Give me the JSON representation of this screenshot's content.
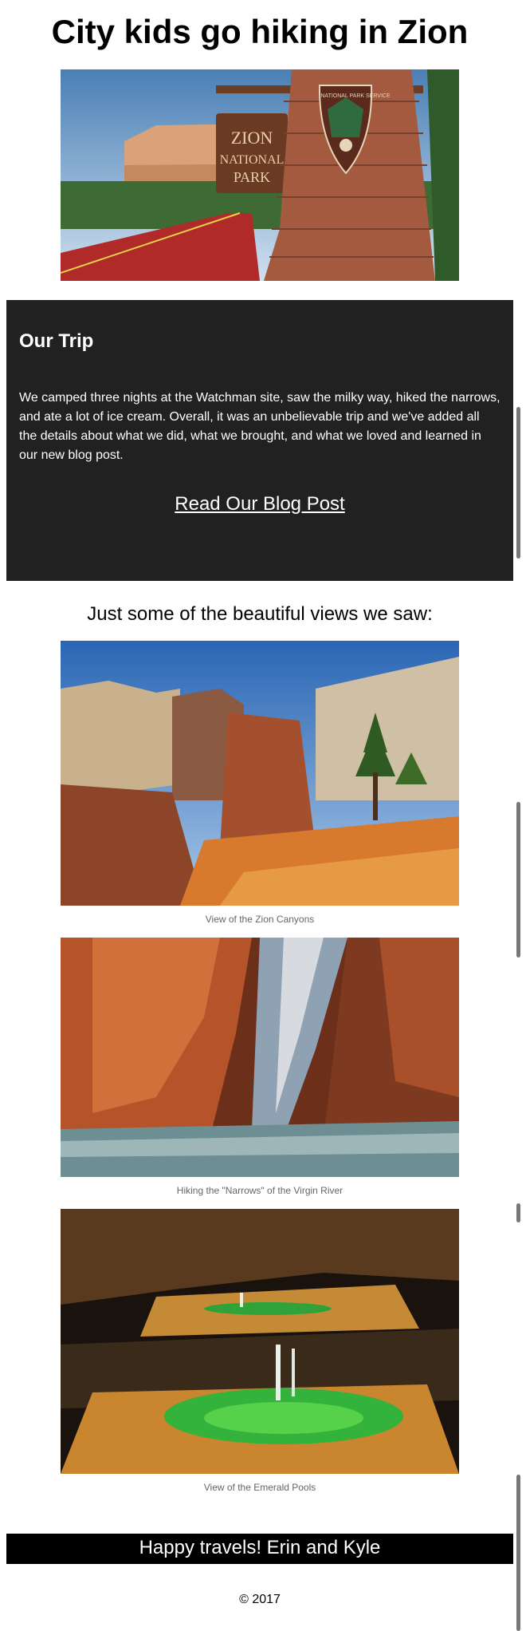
{
  "header": {
    "title": "City kids go hiking in Zion"
  },
  "hero": {
    "sign_line1": "ZION",
    "sign_line2": "NATIONAL",
    "sign_line3": "PARK",
    "badge": "NATIONAL PARK SERVICE"
  },
  "trip": {
    "heading": "Our Trip",
    "body": "We camped three nights at the Watchman site, saw the milky way, hiked the narrows, and ate a lot of ice cream. Overall, it was an unbelievable trip and we've added all the details about what we did, what we brought, and what we loved and learned in our new blog post.",
    "link": "Read Our Blog Post"
  },
  "gallery": {
    "heading": "Just some of the beautiful views we saw:",
    "items": [
      {
        "caption": "View of the Zion Canyons"
      },
      {
        "caption": "Hiking the \"Narrows\" of the Virgin River"
      },
      {
        "caption": "View of the Emerald Pools"
      }
    ]
  },
  "footer": {
    "signoff": "Happy travels! Erin and Kyle",
    "copyright": "© 2017"
  },
  "colors": {
    "dark_panel": "#212121",
    "footer_bar": "#000000",
    "caption": "#666666"
  }
}
